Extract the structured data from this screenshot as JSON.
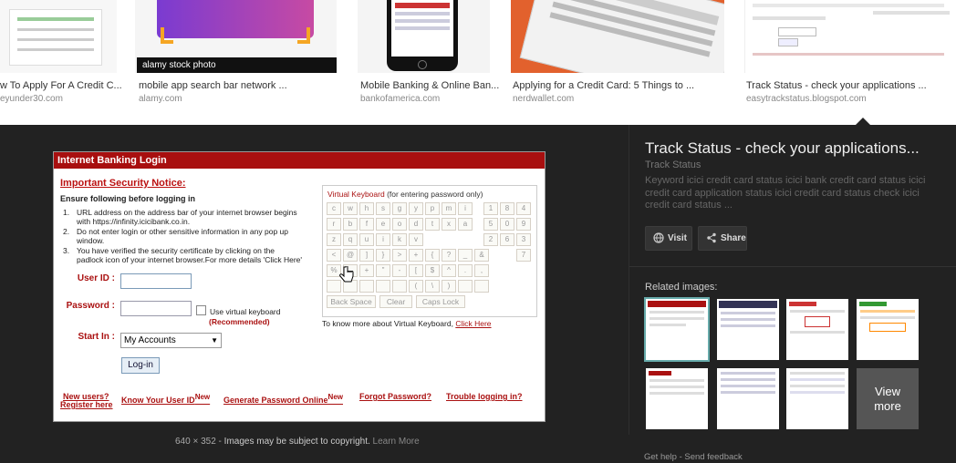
{
  "thumbs": [
    {
      "title": "w To Apply For A Credit C...",
      "source": "eyunder30.com"
    },
    {
      "title": "mobile app search bar network ...",
      "source": "alamy.com",
      "watermark": "alamy stock photo"
    },
    {
      "title": "Mobile Banking & Online Ban...",
      "source": "bankofamerica.com"
    },
    {
      "title": "Applying for a Credit Card: 5 Things to ...",
      "source": "nerdwallet.com"
    },
    {
      "title": "Track Status - check your applications ...",
      "source": "easytrackstatus.blogspot.com"
    }
  ],
  "login": {
    "header": "Internet Banking Login",
    "notice": "Important Security Notice:",
    "ensure": "Ensure following before logging in",
    "rules": [
      {
        "num": "1.",
        "text": "URL address on the address bar of your internet browser begins with https://infinity.icicibank.co.in."
      },
      {
        "num": "2.",
        "text": "Do not enter login or other sensitive information in any pop up window."
      },
      {
        "num": "3.",
        "text": "You have verified the security certificate by clicking on the padlock icon of your internet browser.For more details 'Click Here'"
      }
    ],
    "user_id_label": "User ID :",
    "password_label": "Password :",
    "use_vk": "Use virtual keyboard",
    "recommended": "(Recommended)",
    "start_in_label": "Start In :",
    "start_in_value": "My Accounts",
    "login_button": "Log-in",
    "links": {
      "new_users": "New users?",
      "register": "Register here",
      "know_user_id": "Know Your User ID",
      "new1": "New",
      "generate_pw": "Generate Password Online",
      "new2": "New",
      "forgot_pw": "Forgot Password?",
      "trouble": "Trouble logging in?"
    },
    "vk": {
      "title": "Virtual Keyboard",
      "title_note": "(for entering password only)",
      "rows": [
        [
          "c",
          "w",
          "h",
          "s",
          "g",
          "y",
          "p",
          "m",
          "i"
        ],
        [
          "r",
          "b",
          "f",
          "e",
          "o",
          "d",
          "t",
          "x",
          "a"
        ],
        [
          "z",
          "q",
          "u",
          "i",
          "k",
          "v"
        ],
        [
          "<",
          "@",
          "]",
          "}",
          ">",
          "+",
          "{",
          "?",
          "_",
          "&"
        ],
        [
          "%",
          "",
          "+",
          "\"",
          "-",
          "[",
          "$",
          "^",
          ".",
          ","
        ],
        [
          "",
          "",
          "",
          "",
          "",
          "(",
          "\\",
          ")",
          "",
          ""
        ]
      ],
      "digits": [
        [
          "1",
          "8",
          "4"
        ],
        [
          "5",
          "0",
          "9"
        ],
        [
          "2",
          "6",
          "3"
        ],
        [
          "7"
        ]
      ],
      "back_space": "Back Space",
      "clear": "Clear",
      "caps_lock": "Caps Lock",
      "more_text": "To know more about Virtual Keyboard,",
      "more_link": "Click Here"
    }
  },
  "copyright": {
    "dims": "640 × 352",
    "sep": "-",
    "notice": "Images may be subject to copyright.",
    "learn_more": "Learn More"
  },
  "panel": {
    "title": "Track Status - check your applications...",
    "subtitle": "Track Status",
    "description": "Keyword icici credit card status icici bank credit card status icici credit card application status icici credit card status check icici credit card status ...",
    "visit": "Visit",
    "share": "Share",
    "related_label": "Related images:",
    "view_more_1": "View",
    "view_more_2": "more",
    "get_help": "Get help",
    "sep": "-",
    "send_feedback": "Send feedback"
  }
}
